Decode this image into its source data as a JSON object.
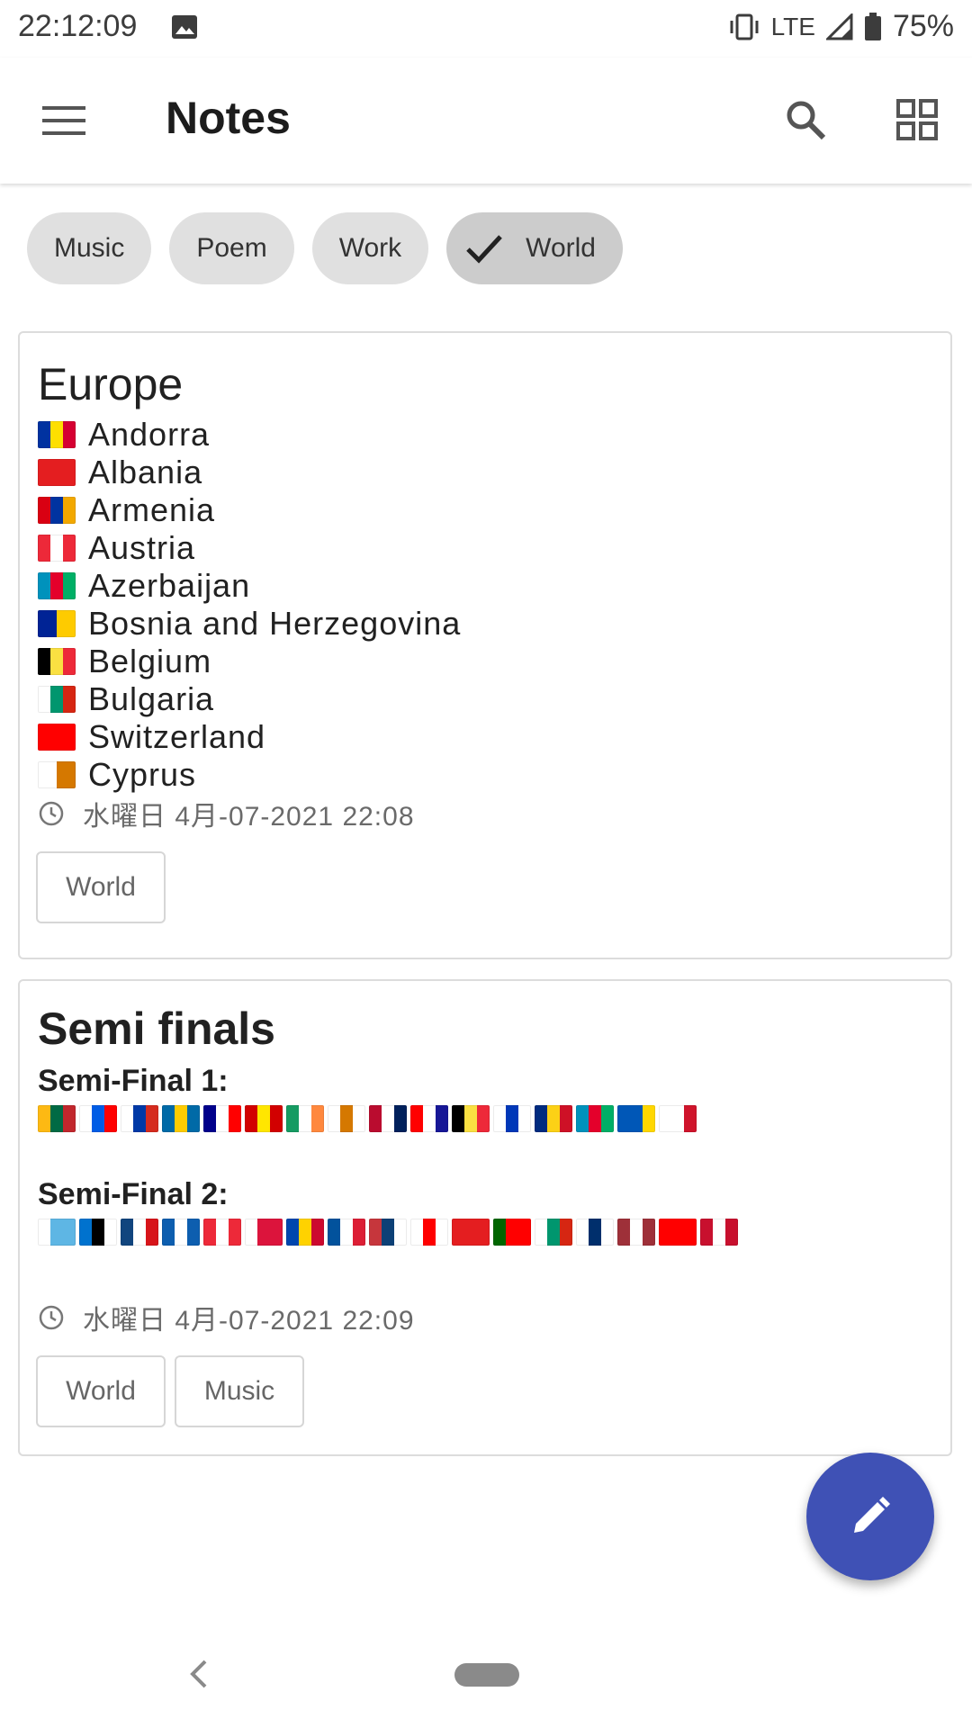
{
  "status_bar": {
    "time": "22:12:09",
    "network": "LTE",
    "battery": "75%",
    "icons": [
      "image-icon",
      "vibrate-icon",
      "signal-icon",
      "battery-icon"
    ]
  },
  "app_bar": {
    "title": "Notes",
    "icons": [
      "menu-icon",
      "search-icon",
      "grid-view-icon"
    ]
  },
  "filter_chips": [
    {
      "label": "Music",
      "selected": false
    },
    {
      "label": "Poem",
      "selected": false
    },
    {
      "label": "Work",
      "selected": false
    },
    {
      "label": "World",
      "selected": true
    }
  ],
  "notes": [
    {
      "title": "Europe",
      "countries": [
        {
          "name": "Andorra",
          "colors": [
            "#0032a0",
            "#fedf00",
            "#d50032"
          ]
        },
        {
          "name": "Albania",
          "colors": [
            "#e41e20"
          ]
        },
        {
          "name": "Armenia",
          "colors": [
            "#d90012",
            "#0033a0",
            "#f2a800"
          ]
        },
        {
          "name": "Austria",
          "colors": [
            "#ed2939",
            "#ffffff",
            "#ed2939"
          ]
        },
        {
          "name": "Azerbaijan",
          "colors": [
            "#0092bc",
            "#e4002b",
            "#00af66"
          ]
        },
        {
          "name": "Bosnia and Herzegovina",
          "colors": [
            "#002395",
            "#fecb00"
          ]
        },
        {
          "name": "Belgium",
          "colors": [
            "#000000",
            "#fae042",
            "#ed2939"
          ]
        },
        {
          "name": "Bulgaria",
          "colors": [
            "#ffffff",
            "#00966e",
            "#d62612"
          ]
        },
        {
          "name": "Switzerland",
          "colors": [
            "#ff0000"
          ]
        },
        {
          "name": "Cyprus",
          "colors": [
            "#ffffff",
            "#d57800"
          ]
        }
      ],
      "timestamp": "水曜日 4月-07-2021 22:08",
      "tags": [
        "World"
      ]
    },
    {
      "title": "Semi finals",
      "sections": [
        {
          "label": "Semi-Final 1:",
          "flags": [
            [
              "#fdb913",
              "#006a44",
              "#c1272d"
            ],
            [
              "#ffffff",
              "#005ce5",
              "#ff0000"
            ],
            [
              "#ffffff",
              "#0039a6",
              "#d52b1e"
            ],
            [
              "#006aa7",
              "#fecc00",
              "#006aa7"
            ],
            [
              "#00008b",
              "#ffffff",
              "#ff0000"
            ],
            [
              "#d20000",
              "#ffe600",
              "#d20000"
            ],
            [
              "#169b62",
              "#ffffff",
              "#ff883e"
            ],
            [
              "#ffffff",
              "#d57800",
              "#ffffff"
            ],
            [
              "#ba0c2f",
              "#ffffff",
              "#00205b"
            ],
            [
              "#ff0000",
              "#ffffff",
              "#171796"
            ],
            [
              "#000000",
              "#fae042",
              "#ed2939"
            ],
            [
              "#ffffff",
              "#0038b8",
              "#ffffff"
            ],
            [
              "#002b7f",
              "#fcd116",
              "#ce1126"
            ],
            [
              "#0092bc",
              "#e4002b",
              "#00af66"
            ],
            [
              "#0057b7",
              "#0057b7",
              "#ffd700"
            ],
            [
              "#ffffff",
              "#ffffff",
              "#cf142b"
            ]
          ]
        },
        {
          "label": "Semi-Final 2:",
          "flags": [
            [
              "#ffffff",
              "#5eb6e4",
              "#5eb6e4"
            ],
            [
              "#0072ce",
              "#000000",
              "#ffffff"
            ],
            [
              "#11457e",
              "#ffffff",
              "#d7141a"
            ],
            [
              "#0d5eaf",
              "#ffffff",
              "#0d5eaf"
            ],
            [
              "#ed2939",
              "#ffffff",
              "#ed2939"
            ],
            [
              "#ffffff",
              "#dc143c",
              "#dc143c"
            ],
            [
              "#0046ae",
              "#ffd200",
              "#cc092f"
            ],
            [
              "#02529c",
              "#ffffff",
              "#dc1e35"
            ],
            [
              "#c6363c",
              "#0c4076",
              "#ffffff"
            ],
            [
              "#ffffff",
              "#ff0000",
              "#ffffff"
            ],
            [
              "#e41e20",
              "#e41e20",
              "#e41e20"
            ],
            [
              "#006600",
              "#ff0000",
              "#ff0000"
            ],
            [
              "#ffffff",
              "#00966e",
              "#d62612"
            ],
            [
              "#ffffff",
              "#002f6c",
              "#ffffff"
            ],
            [
              "#9e3039",
              "#ffffff",
              "#9e3039"
            ],
            [
              "#ff0000",
              "#ff0000",
              "#ff0000"
            ],
            [
              "#c8102e",
              "#ffffff",
              "#c8102e"
            ]
          ]
        }
      ],
      "timestamp": "水曜日 4月-07-2021 22:09",
      "tags": [
        "World",
        "Music"
      ]
    }
  ],
  "fab": {
    "icon": "pencil-icon",
    "color": "#3f51b5"
  }
}
